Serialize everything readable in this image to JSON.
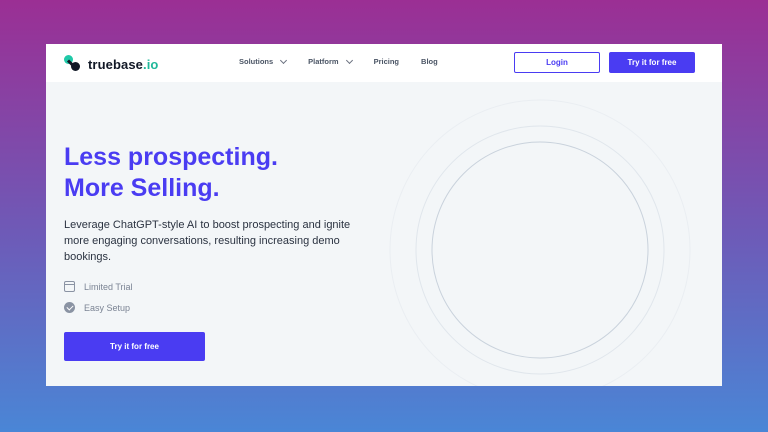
{
  "header": {
    "logo_text": "truebase",
    "logo_suffix": ".io",
    "nav": [
      {
        "label": "Solutions",
        "has_dropdown": true
      },
      {
        "label": "Platform",
        "has_dropdown": true
      },
      {
        "label": "Pricing",
        "has_dropdown": false
      },
      {
        "label": "Blog",
        "has_dropdown": false
      }
    ],
    "login_label": "Login",
    "try_label": "Try it for free"
  },
  "hero": {
    "title_line1": "Less prospecting.",
    "title_line2": "More Selling.",
    "subtitle": "Leverage ChatGPT-style AI to boost prospecting and ignite more engaging conversations, resulting increasing demo bookings.",
    "features": [
      {
        "icon": "calendar-icon",
        "label": "Limited Trial"
      },
      {
        "icon": "check-circle-icon",
        "label": "Easy Setup"
      }
    ],
    "cta_label": "Try it for free"
  },
  "colors": {
    "accent": "#4a3cf2",
    "logo_teal": "#20c9a8",
    "text_dark": "#111826"
  }
}
